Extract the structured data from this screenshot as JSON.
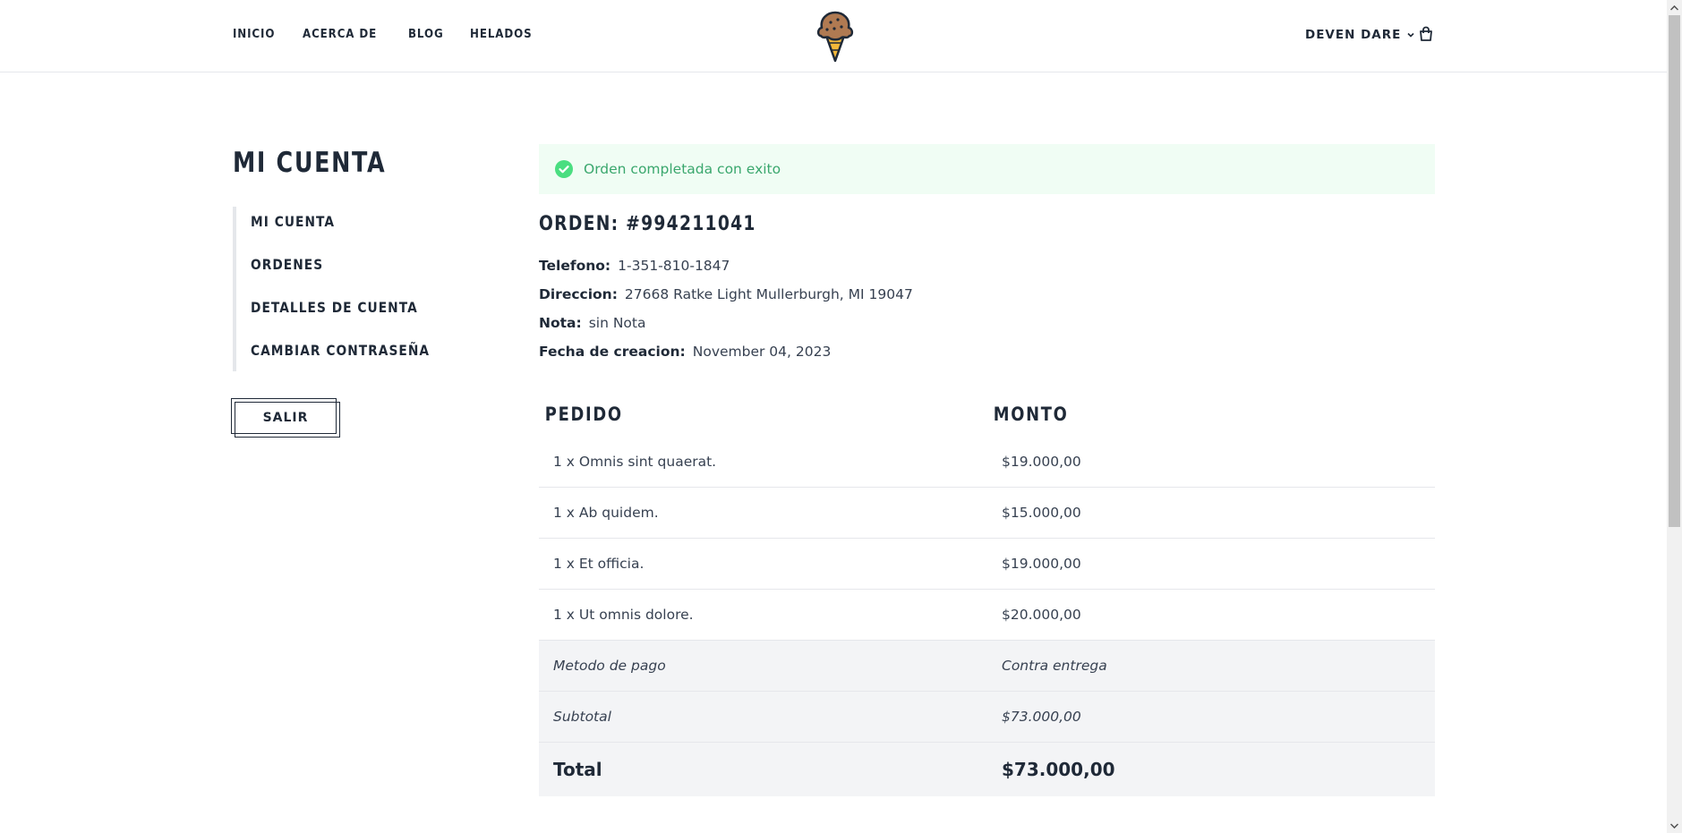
{
  "header": {
    "nav": [
      "INICIO",
      "ACERCA DE",
      "BLOG",
      "HELADOS"
    ],
    "user_name": "DEVEN DARE",
    "logo_icon": "ice-cream-cone-icon",
    "cart_icon": "shopping-bag-icon"
  },
  "sidebar": {
    "title": "MI CUENTA",
    "items": [
      "MI CUENTA",
      "ORDENES",
      "DETALLES DE CUENTA",
      "CAMBIAR CONTRASEÑA"
    ],
    "logout_label": "SALIR"
  },
  "alert": {
    "message": "Orden completada con exito",
    "color": "#3aa76d",
    "background": "#f0fdf4"
  },
  "order": {
    "title": "ORDEN: #994211041",
    "phone_label": "Telefono:",
    "phone": "1-351-810-1847",
    "address_label": "Direccion:",
    "address": "27668 Ratke Light Mullerburgh, MI 19047",
    "note_label": "Nota:",
    "note": "sin Nota",
    "created_label": "Fecha de creacion:",
    "created": "November 04, 2023"
  },
  "table": {
    "headers": [
      "PEDIDO",
      "MONTO"
    ],
    "items": [
      {
        "name": "1 x Omnis sint quaerat.",
        "amount": "$19.000,00"
      },
      {
        "name": "1 x Ab quidem.",
        "amount": "$15.000,00"
      },
      {
        "name": "1 x Et officia.",
        "amount": "$19.000,00"
      },
      {
        "name": "1 x Ut omnis dolore.",
        "amount": "$20.000,00"
      }
    ],
    "payment_label": "Metodo de pago",
    "payment": "Contra entrega",
    "subtotal_label": "Subtotal",
    "subtotal": "$73.000,00",
    "total_label": "Total",
    "total": "$73.000,00"
  }
}
